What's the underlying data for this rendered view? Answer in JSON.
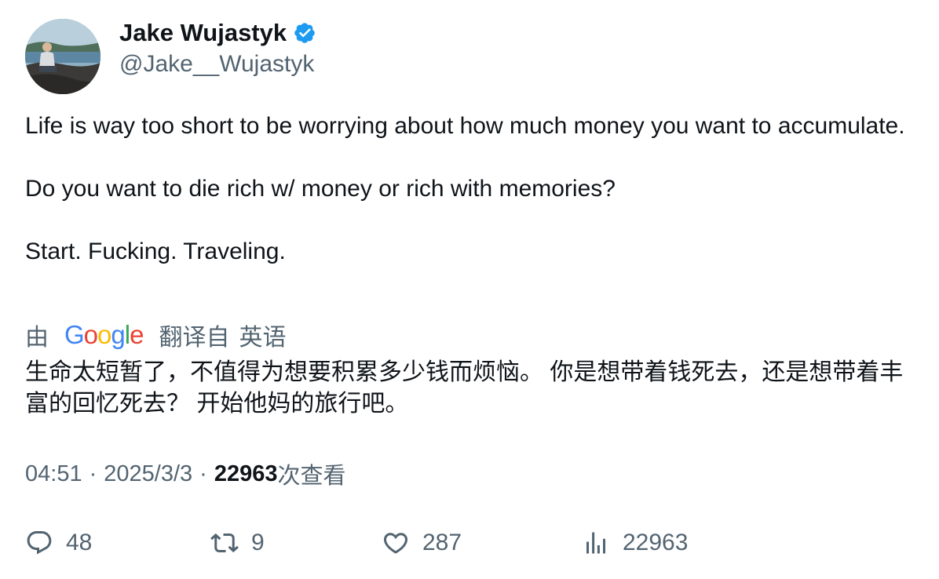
{
  "user": {
    "display_name": "Jake Wujastyk",
    "handle": "@Jake__Wujastyk",
    "verified": true,
    "avatar_icon": "profile-photo"
  },
  "tweet": {
    "paragraphs": [
      "Life is way too short to be worrying about how much money you want to accumulate.",
      "Do you want to die rich w/ money or rich with memories?",
      "Start. Fucking. Traveling."
    ]
  },
  "translation": {
    "prefix": "由",
    "provider": "Google",
    "source_label": "翻译自",
    "language": "英语",
    "text": "生命太短暂了，不值得为想要积累多少钱而烦恼。 你是想带着钱死去，还是想带着丰富的回忆死去？ 开始他妈的旅行吧。"
  },
  "meta": {
    "time": "04:51",
    "date": "2025/3/3",
    "views": "22963",
    "views_suffix": "次查看"
  },
  "actions": {
    "replies": "48",
    "retweets": "9",
    "likes": "287",
    "views": "22963"
  },
  "colors": {
    "text": "#0f1419",
    "secondary": "#536471",
    "verified": "#1d9bf0"
  }
}
